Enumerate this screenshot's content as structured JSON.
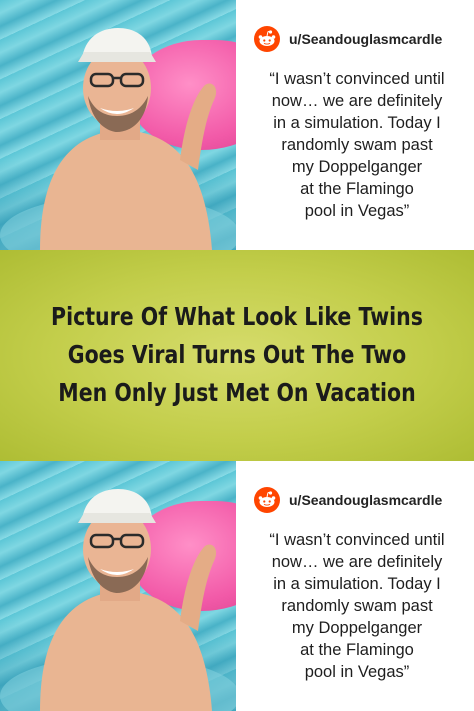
{
  "panels": [
    {
      "username": "u/Seandouglasmcardle",
      "quote_lines": [
        "“I wasn’t convinced until",
        "now… we are definitely",
        "in a simulation. Today I",
        "randomly swam past",
        "my Doppelganger",
        "at the Flamingo",
        "pool in Vegas”"
      ]
    },
    {
      "username": "u/Seandouglasmcardle",
      "quote_lines": [
        "“I wasn’t convinced until",
        "now… we are definitely",
        "in a simulation. Today I",
        "randomly swam past",
        "my Doppelganger",
        "at the Flamingo",
        "pool in Vegas”"
      ]
    }
  ],
  "headline_lines": [
    "Picture Of What Look Like Twins",
    "Goes Viral Turns Out The Two",
    "Men Only Just Met On Vacation"
  ],
  "icons": {
    "author_icon": "reddit-logo-icon"
  },
  "colors": {
    "banner": "#c3ce4b",
    "reddit_orange": "#ff4500",
    "float_pink": "#f25aa8",
    "pool_blue": "#5cc6d6"
  }
}
